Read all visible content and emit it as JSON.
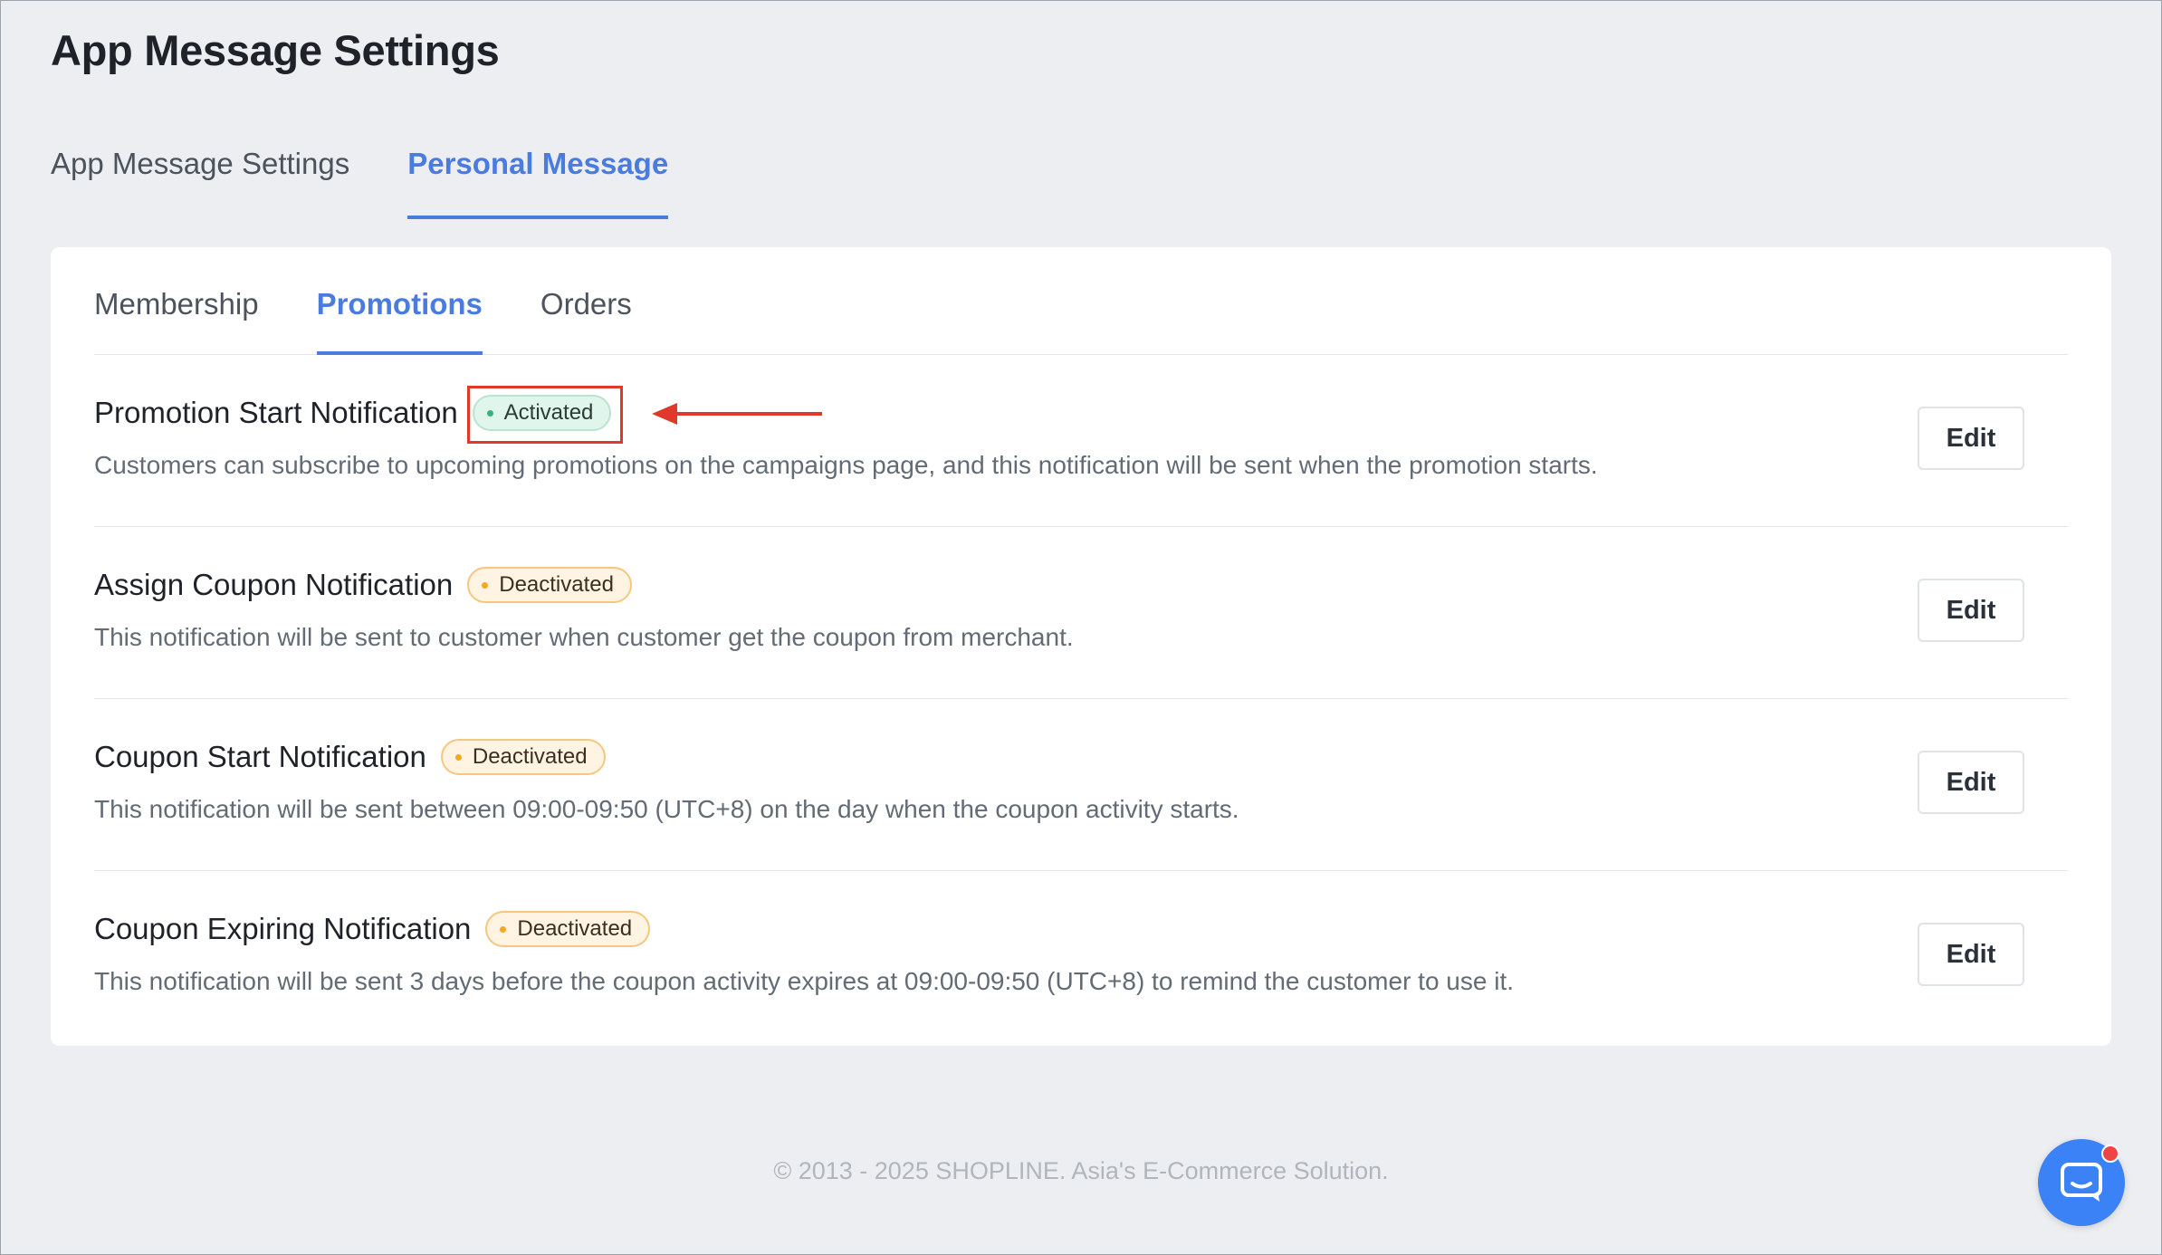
{
  "page": {
    "title": "App Message Settings"
  },
  "top_tabs": [
    {
      "label": "App Message Settings",
      "active": false
    },
    {
      "label": "Personal Message",
      "active": true
    }
  ],
  "sub_tabs": [
    {
      "label": "Membership",
      "active": false
    },
    {
      "label": "Promotions",
      "active": true
    },
    {
      "label": "Orders",
      "active": false
    }
  ],
  "notifications": [
    {
      "title": "Promotion Start Notification",
      "status": "Activated",
      "description": "Customers can subscribe to upcoming promotions on the campaigns page, and this notification will be sent when the promotion starts.",
      "edit_label": "Edit"
    },
    {
      "title": "Assign Coupon Notification",
      "status": "Deactivated",
      "description": "This notification will be sent to customer when customer get the coupon from merchant.",
      "edit_label": "Edit"
    },
    {
      "title": "Coupon Start Notification",
      "status": "Deactivated",
      "description": "This notification will be sent between 09:00-09:50 (UTC+8) on the day when the coupon activity starts.",
      "edit_label": "Edit"
    },
    {
      "title": "Coupon Expiring Notification",
      "status": "Deactivated",
      "description": "This notification will be sent 3 days before the coupon activity expires at 09:00-09:50 (UTC+8) to remind the customer to use it.",
      "edit_label": "Edit"
    }
  ],
  "footer": {
    "text": "© 2013 - 2025  SHOPLINE. Asia's E-Commerce Solution."
  },
  "icons": {
    "chat": "chat-bubble-icon",
    "annotation_arrow": "arrow-left-icon"
  },
  "colors": {
    "accent": "#4a7ce0",
    "activated_dot": "#36b37e",
    "deactivated_dot": "#f5a623",
    "annotation": "#e0392b",
    "chat_button": "#3b82f6"
  }
}
